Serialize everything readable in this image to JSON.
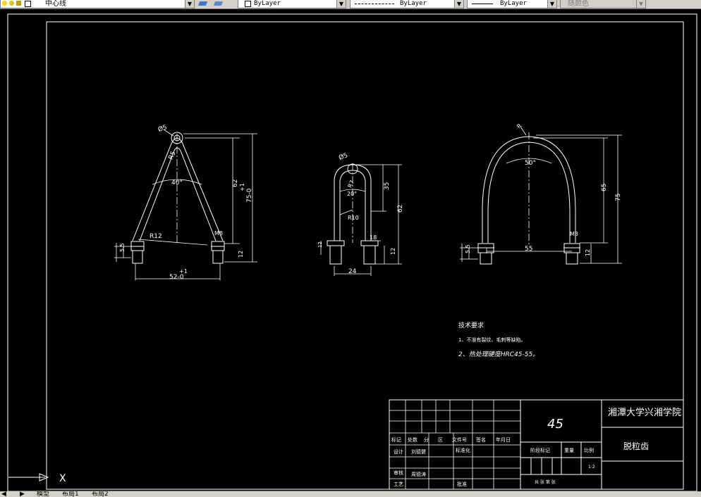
{
  "toolbar": {
    "layer_name": "中心线",
    "color_value": "ByLayer",
    "linetype_value": "ByLayer",
    "lineweight_value": "ByLayer",
    "plotstyle_value": "随颜色"
  },
  "views": {
    "left": {
      "dim_dia": "Ø5",
      "dim_r": "R5",
      "dim_angle": "40°",
      "dim_h1": "62",
      "dim_h2": "75-0",
      "dim_h2_tol": "+1",
      "dim_r2": "R12",
      "dim_m": "M8",
      "dim_w": "52-0",
      "dim_w_tol": "+1",
      "dim_b1": "12",
      "dim_b2": "5.5"
    },
    "middle": {
      "dim_dia": "Ø5",
      "dim_r": "R7",
      "dim_angle": "20°",
      "dim_r2": "R10",
      "dim_h1": "35",
      "dim_h2": "62",
      "dim_b1": "12",
      "dim_b2": "12",
      "dim_b3": "18",
      "dim_w": "24"
    },
    "right": {
      "dim_r": "R",
      "dim_angle": "50°",
      "dim_h1": "65",
      "dim_h2": "75",
      "dim_m": "M8",
      "dim_w": "55",
      "dim_b1": "12",
      "dim_b2": "5.5"
    }
  },
  "notes": {
    "title": "技术要求",
    "line1": "1、不准有裂纹、毛刺等缺陷。",
    "line2": "2、热处理硬度HRC45-55。"
  },
  "title_block": {
    "material": "45",
    "school": "湘潭大学兴湘学院",
    "part_name": "脱粒齿",
    "h_mark": "标记",
    "h_count": "处数",
    "h_zone": "分",
    "h_zone2": "区",
    "h_docno": "文件号",
    "h_sign": "签名",
    "h_date": "年月日",
    "r_design": "设计",
    "r_design_name": "刘德健",
    "r_std": "标准化",
    "r_check": "审核",
    "r_check_name": "周德涛",
    "r_craft": "工艺",
    "r_approve": "批准",
    "stage_mark": "阶段标记",
    "weight": "重量",
    "scale": "比例",
    "scale_val": "1:2",
    "sheet_info": "共  张  第  张"
  },
  "ucs": {
    "x_label": "X"
  },
  "tabs": {
    "model": "模型",
    "layout1": "布局1",
    "layout2": "布局2"
  }
}
